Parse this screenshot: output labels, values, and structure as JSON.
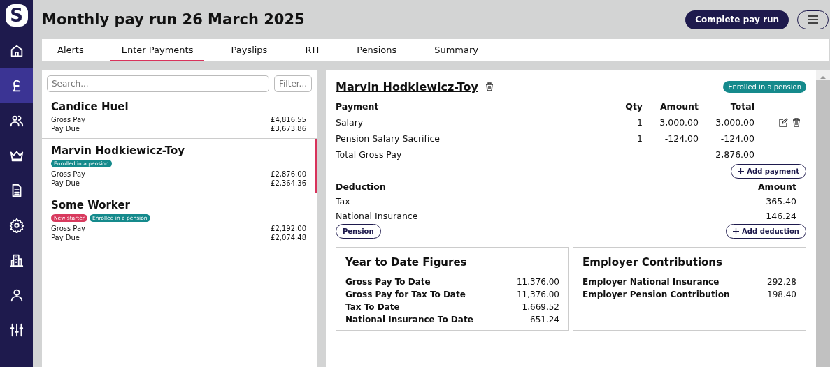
{
  "nav": [
    {
      "selected": false
    },
    {
      "selected": true
    },
    {
      "selected": false
    },
    {
      "selected": false
    },
    {
      "selected": false
    },
    {
      "selected": false
    },
    {
      "selected": false
    },
    {
      "selected": false
    },
    {
      "selected": false
    }
  ],
  "logo": "S",
  "title": "Monthly pay run 26 March 2025",
  "complete_button": "Complete pay run",
  "tabs": [
    {
      "label": "Alerts",
      "selected": false
    },
    {
      "label": "Enter Payments",
      "selected": true
    },
    {
      "label": "Payslips",
      "selected": false
    },
    {
      "label": "RTI",
      "selected": false
    },
    {
      "label": "Pensions",
      "selected": false
    },
    {
      "label": "Summary",
      "selected": false
    }
  ],
  "search": {
    "placeholder": "Search..."
  },
  "filter": {
    "placeholder": "Filter..."
  },
  "employees": [
    {
      "name": "Candice Huel",
      "selected": false,
      "rows": [
        {
          "label": "Gross Pay",
          "value": "£4,816.55"
        },
        {
          "label": "Pay Due",
          "value": "£3,673.86"
        }
      ]
    },
    {
      "name": "Marvin Hodkiewicz-Toy",
      "selected": true,
      "tags": [
        {
          "label": "Enrolled in a pension",
          "color": "#158a8c"
        }
      ],
      "rows": [
        {
          "label": "Gross Pay",
          "value": "£2,876.00"
        },
        {
          "label": "Pay Due",
          "value": "£2,364.36"
        }
      ]
    },
    {
      "name": "Some Worker",
      "selected": false,
      "tags": [
        {
          "label": "New starter",
          "color": "#d83a5e"
        },
        {
          "label": "Enrolled in a pension",
          "color": "#158a8c"
        }
      ],
      "rows": [
        {
          "label": "Gross Pay",
          "value": "£2,192.00"
        },
        {
          "label": "Pay Due",
          "value": "£2,074.48"
        }
      ]
    }
  ],
  "detail": {
    "name": "Marvin Hodkiewicz-Toy",
    "tag": {
      "label": "Enrolled in a pension",
      "color": "#158a8c"
    },
    "payment_columns": [
      "Payment",
      "Qty",
      "Amount",
      "Total"
    ],
    "payments": [
      {
        "name": "Salary",
        "qty": "1",
        "amount": "3,000.00",
        "total": "3,000.00",
        "editable": true
      },
      {
        "name": "Pension Salary Sacrifice",
        "qty": "1",
        "amount": "-124.00",
        "total": "-124.00"
      }
    ],
    "total_label": "Total Gross Pay",
    "total_value": "2,876.00",
    "add_payment": "Add payment",
    "deduction_columns": [
      "Deduction",
      "Amount"
    ],
    "deductions": [
      {
        "name": "Tax",
        "amount": "365.40"
      },
      {
        "name": "National Insurance",
        "amount": "146.24"
      }
    ],
    "pension_button": "Pension",
    "add_deduction": "Add deduction",
    "cards": [
      {
        "title": "Year to Date Figures",
        "rows": [
          {
            "label": "Gross Pay To Date",
            "value": "11,376.00"
          },
          {
            "label": "Gross Pay for Tax To Date",
            "value": "11,376.00"
          },
          {
            "label": "Tax To Date",
            "value": "1,669.52"
          },
          {
            "label": "National Insurance To Date",
            "value": "651.24"
          }
        ]
      },
      {
        "title": "Employer Contributions",
        "rows": [
          {
            "label": "Employer National Insurance",
            "value": "292.28"
          },
          {
            "label": "Employer Pension Contribution",
            "value": "198.40"
          }
        ]
      }
    ]
  }
}
